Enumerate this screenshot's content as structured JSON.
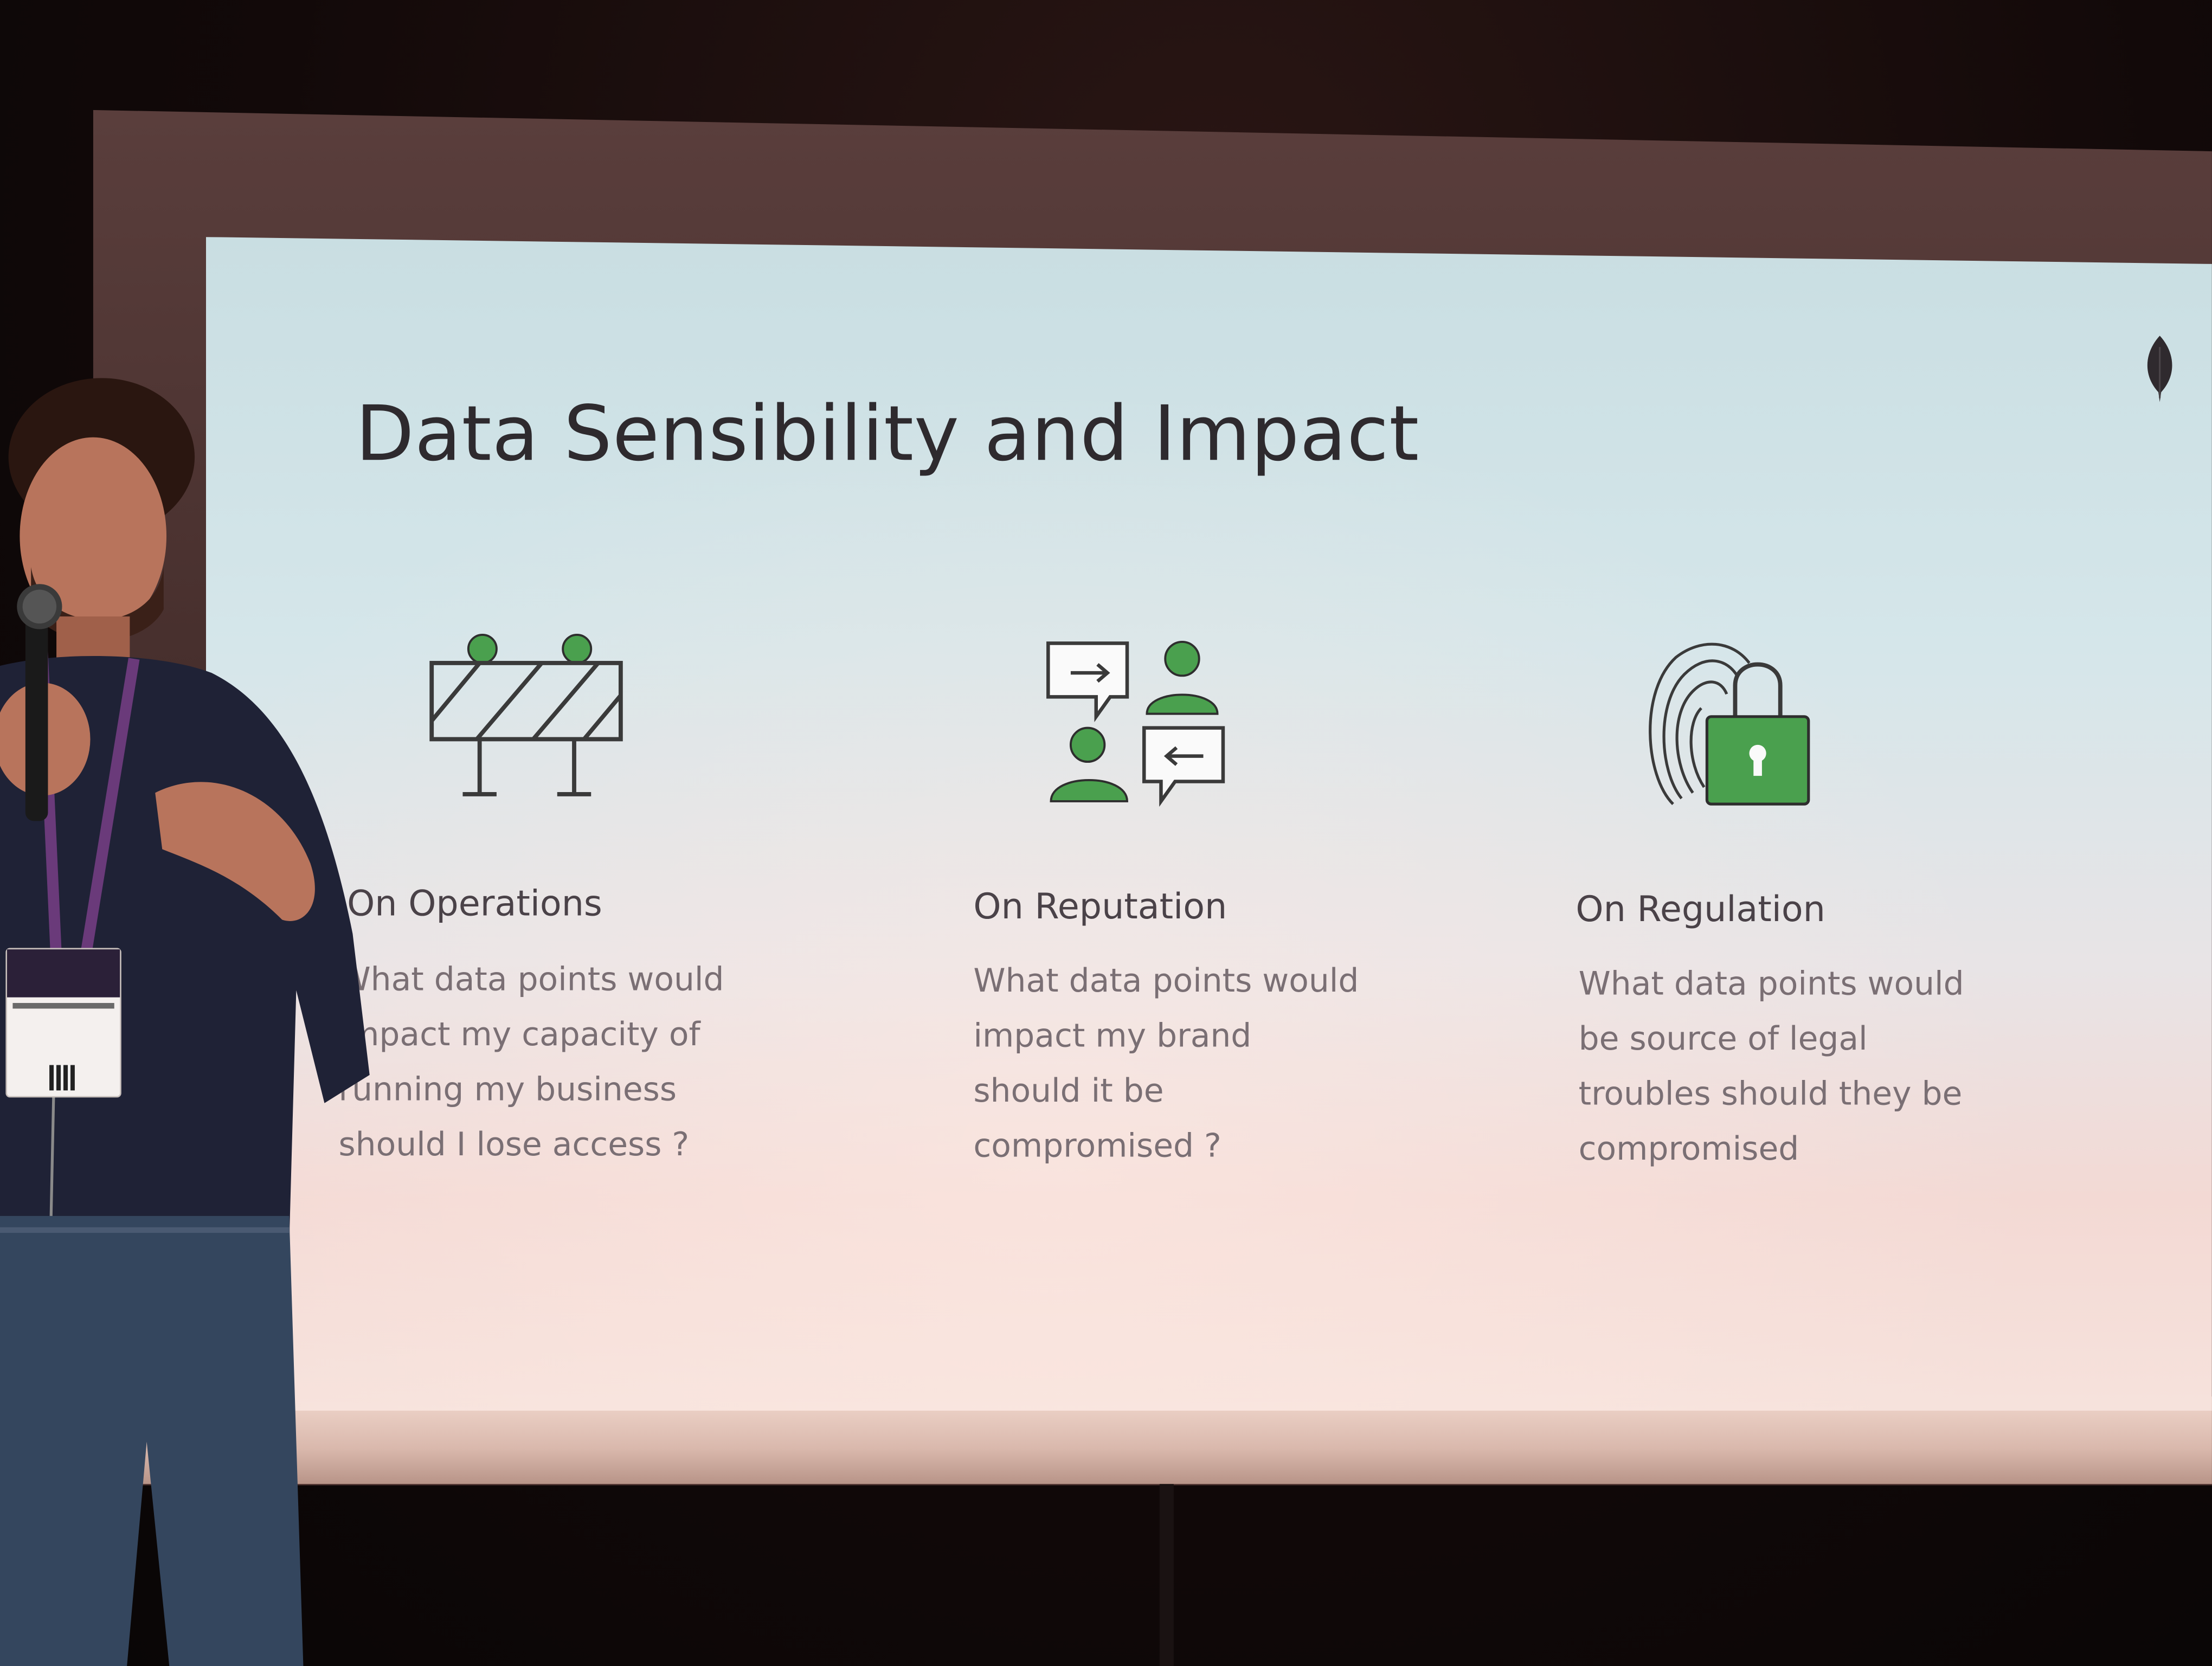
{
  "slide": {
    "title": "Data Sensibility and Impact",
    "columns": [
      {
        "heading": "On Operations",
        "icon": "barrier-icon",
        "text": "What data points would\nimpact my capacity of\nrunning my business\nshould I lose access ?"
      },
      {
        "heading": "On Reputation",
        "icon": "people-exchange-icon",
        "text": "What data points would\nimpact my brand\nshould it be\ncompromised ?"
      },
      {
        "heading": "On Regulation",
        "icon": "fingerprint-lock-icon",
        "text": "What data points would\nbe source of legal\ntroubles should they be\ncompromised"
      }
    ]
  },
  "colors": {
    "icon_green": "#4aa04e",
    "icon_stroke": "#3a3a3a",
    "title_color": "#2e2a2e"
  }
}
